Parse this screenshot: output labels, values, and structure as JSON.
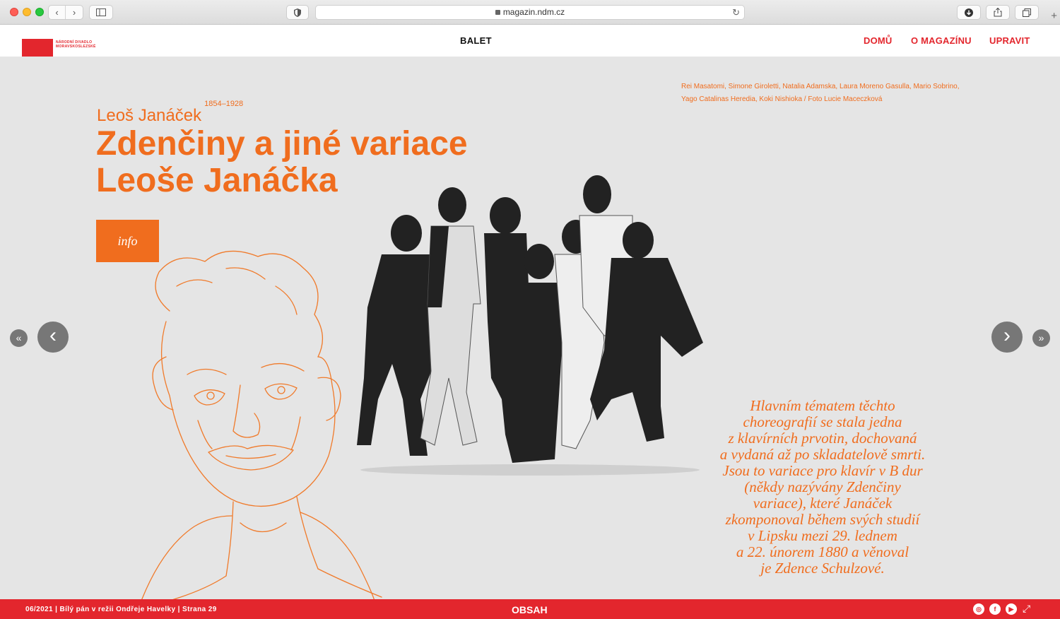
{
  "browser": {
    "url": "magazin.ndm.cz",
    "back_glyph": "‹",
    "forward_glyph": "›",
    "reload_glyph": "↻",
    "new_tab_glyph": "+",
    "icons": [
      "sidebar-icon",
      "shield-icon",
      "download-icon",
      "share-icon",
      "tabs-icon"
    ]
  },
  "header": {
    "logo_lines": [
      "NÁRODNÍ DIVADLO",
      "MORAVSKOSLEZSKÉ"
    ],
    "section": "BALET",
    "nav": [
      "DOMŮ",
      "O MAGAZÍNU",
      "UPRAVIT"
    ]
  },
  "main": {
    "caption": "Rei Masatomi, Simone Giroletti, Natalia Adamska, Laura Moreno Gasulla, Mario Sobrino, Yago Catalinas Heredia, Koki Nishioka / Foto Lucie Maceczková",
    "composer": "Leoš Janáček",
    "years": "1854–1928",
    "title_line1": "Zdenčiny a jiné variace",
    "title_line2": "Leoše Janáčka",
    "info_button": "info",
    "quote_lines": [
      "Hlavním tématem těchto",
      "choreografií se stala jedna",
      "z klavírních prvotin, dochovaná",
      "a vydaná až po skladatelově smrti.",
      "Jsou to variace pro klavír v B dur",
      "(někdy nazývány Zdenčiny",
      "variace), které Janáček",
      "zkomponoval během svých studií",
      "v Lipsku mezi 29. lednem",
      "a 22. únorem 1880 a věnoval",
      "je Zdence Schulzové."
    ],
    "nav_glyphs": {
      "prev": "‹",
      "next": "›",
      "first": "«",
      "last": "»"
    }
  },
  "footer": {
    "issue": "06/2021 | Bílý pán v režii Ondřeje Havelky | Strana 29",
    "center": "OBSAH",
    "social": [
      "instagram-icon",
      "facebook-icon",
      "youtube-icon"
    ],
    "social_glyphs": [
      "◎",
      "f",
      "▶"
    ],
    "expand_glyph": "⤢"
  },
  "colors": {
    "accent": "#f06d1e",
    "brand_red": "#e3262d",
    "background": "#e5e5e5"
  }
}
